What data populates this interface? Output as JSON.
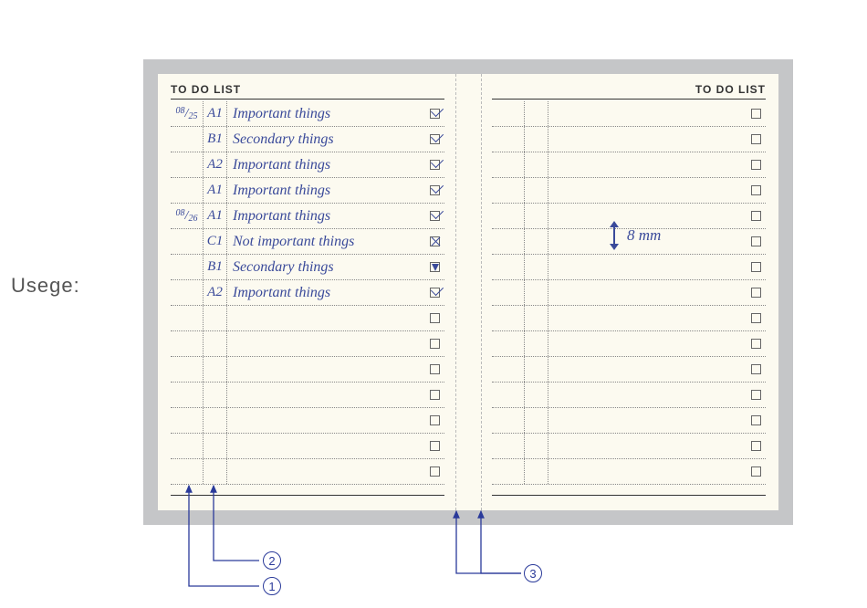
{
  "labels": {
    "usage": "Usege:",
    "todo_header": "TO  DO  LIST",
    "measure_label": "8 mm"
  },
  "left_page": {
    "rows": [
      {
        "date": "08/25",
        "prio": "A1",
        "task": "Important things",
        "check": "checked"
      },
      {
        "date": "",
        "prio": "B1",
        "task": "Secondary things",
        "check": "checked"
      },
      {
        "date": "",
        "prio": "A2",
        "task": "Important things",
        "check": "checked"
      },
      {
        "date": "",
        "prio": "A1",
        "task": "Important things",
        "check": "checked"
      },
      {
        "date": "08/26",
        "prio": "A1",
        "task": "Important things",
        "check": "checked"
      },
      {
        "date": "",
        "prio": "C1",
        "task": "Not important things",
        "check": "crossed"
      },
      {
        "date": "",
        "prio": "B1",
        "task": "Secondary things",
        "check": "tri"
      },
      {
        "date": "",
        "prio": "A2",
        "task": "Important things",
        "check": "checked"
      },
      {
        "date": "",
        "prio": "",
        "task": "",
        "check": ""
      },
      {
        "date": "",
        "prio": "",
        "task": "",
        "check": ""
      },
      {
        "date": "",
        "prio": "",
        "task": "",
        "check": ""
      },
      {
        "date": "",
        "prio": "",
        "task": "",
        "check": ""
      },
      {
        "date": "",
        "prio": "",
        "task": "",
        "check": ""
      },
      {
        "date": "",
        "prio": "",
        "task": "",
        "check": ""
      },
      {
        "date": "",
        "prio": "",
        "task": "",
        "check": ""
      }
    ]
  },
  "right_page": {
    "row_count": 15
  },
  "callouts": {
    "c1": "1",
    "c2": "2",
    "c3": "3"
  }
}
